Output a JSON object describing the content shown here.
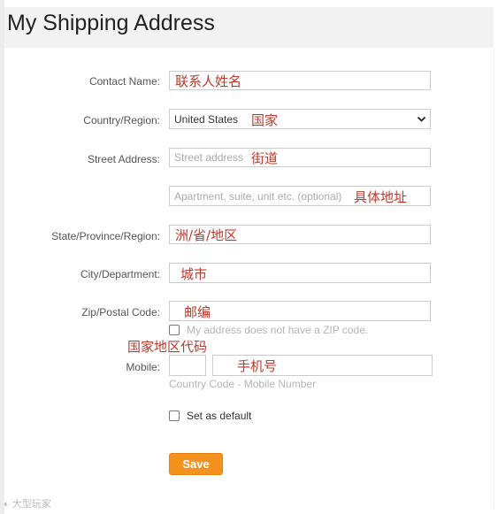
{
  "page": {
    "title": "My Shipping Address"
  },
  "form": {
    "contact_name": {
      "label": "Contact Name:",
      "annotation": "联系人姓名"
    },
    "country": {
      "label": "Country/Region:",
      "value": "United States",
      "annotation": "国家"
    },
    "street": {
      "label": "Street Address:",
      "placeholder": "Street address",
      "annotation": "街道"
    },
    "apartment": {
      "placeholder": "Apartment, suite, unit etc. (optional)",
      "annotation": "具体地址"
    },
    "state": {
      "label": "State/Province/Region:",
      "annotation": "洲/省/地区"
    },
    "city": {
      "label": "City/Department:",
      "annotation": "城市"
    },
    "zip": {
      "label": "Zip/Postal Code:",
      "annotation": "邮编",
      "no_zip_label": "My address does not have a ZIP code."
    },
    "mobile": {
      "label": "Mobile:",
      "country_code_annotation": "国家地区代码",
      "number_annotation": "手机号",
      "hint": "Country Code - Mobile Number"
    },
    "default": {
      "label": "Set as default"
    },
    "save_label": "Save"
  },
  "watermark": "大型玩家",
  "colors": {
    "accent": "#f5921e",
    "annotation": "#c0392b"
  }
}
